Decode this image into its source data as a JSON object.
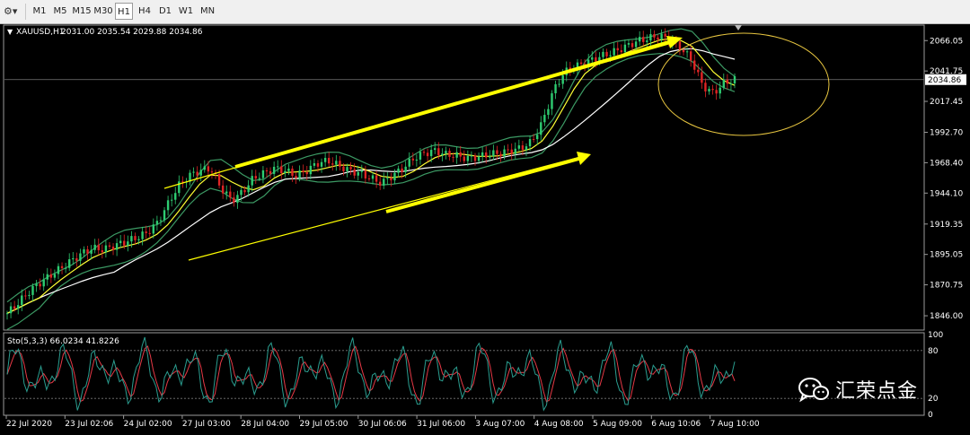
{
  "toolbar": {
    "icon": "chart-settings-icon",
    "timeframes": [
      "M1",
      "M5",
      "M15",
      "M30",
      "H1",
      "H4",
      "D1",
      "W1",
      "MN"
    ],
    "active": "H1"
  },
  "chart_data": {
    "type": "candlestick",
    "symbol_label": "XAUUSD,H1",
    "ohlc_label": "2031.00 2035.54 2029.88 2034.86",
    "current_price": 2034.86,
    "current_price_label": "2034.86",
    "price_ticks": [
      "2066.05",
      "2041.75",
      "2017.45",
      "1992.70",
      "1968.40",
      "1944.10",
      "1919.35",
      "1895.05",
      "1870.75",
      "1846.00"
    ],
    "price_tick_values": [
      2066.05,
      2041.75,
      2017.45,
      1992.7,
      1968.4,
      1944.1,
      1919.35,
      1895.05,
      1870.75,
      1846.0
    ],
    "ylim": [
      1836.0,
      2077.0
    ],
    "date_ticks": [
      "22 Jul 2020",
      "23 Jul 02:06",
      "24 Jul 02:00",
      "27 Jul 03:00",
      "28 Jul 04:00",
      "29 Jul 05:00",
      "30 Jul 06:06",
      "31 Jul 06:00",
      "3 Aug 07:00",
      "4 Aug 08:00",
      "5 Aug 09:00",
      "6 Aug 10:06",
      "7 Aug 10:00"
    ],
    "close_path": [
      1848,
      1856,
      1865,
      1872,
      1878,
      1884,
      1890,
      1896,
      1900,
      1899,
      1902,
      1905,
      1908,
      1912,
      1920,
      1935,
      1950,
      1958,
      1962,
      1964,
      1948,
      1938,
      1945,
      1956,
      1960,
      1964,
      1962,
      1958,
      1962,
      1968,
      1970,
      1966,
      1962,
      1960,
      1956,
      1952,
      1958,
      1964,
      1972,
      1976,
      1978,
      1975,
      1974,
      1972,
      1973,
      1975,
      1976,
      1978,
      1980,
      1985,
      2000,
      2025,
      2040,
      2045,
      2048,
      2052,
      2055,
      2058,
      2062,
      2066,
      2068,
      2070,
      2066,
      2060,
      2050,
      2030,
      2024,
      2032,
      2034.86
    ],
    "indicators": {
      "bollinger_color": "#3c9a64",
      "ma_fast_color": "#ffff33",
      "ma_slow_color": "#ffffff"
    },
    "annotation_color": "#ffff00",
    "stochastic": {
      "label": "Sto(5,3,3) 66.0234 41.8226",
      "k_value": 66.0234,
      "d_value": 41.8226,
      "levels": [
        "100",
        "80",
        "20",
        "0"
      ],
      "level_values": [
        100,
        80,
        20,
        0
      ],
      "k_color": "#2a9d8f",
      "d_color": "#e63946"
    }
  },
  "watermark": {
    "logo": "wechat-icon",
    "text": "汇荣点金"
  }
}
